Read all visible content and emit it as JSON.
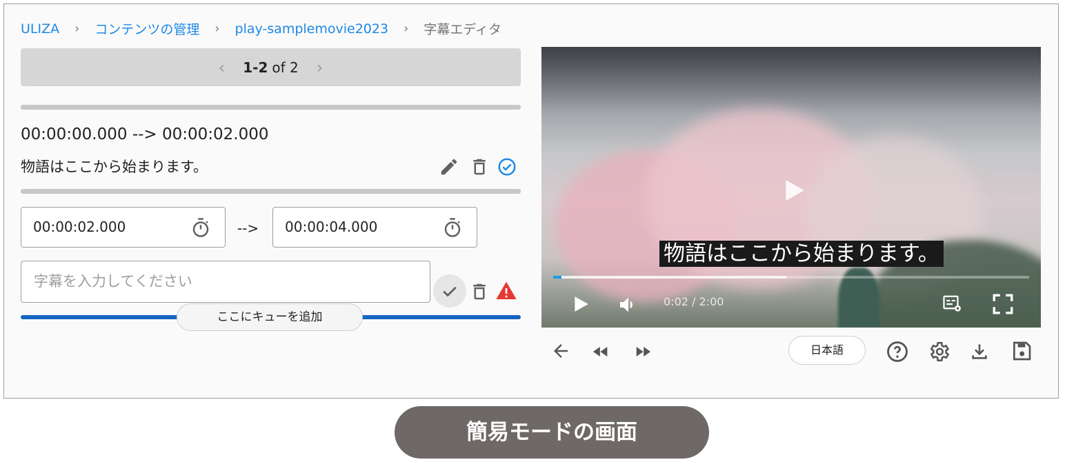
{
  "breadcrumb": {
    "items": [
      "ULIZA",
      "コンテンツの管理",
      "play-samplemovie2023"
    ],
    "current": "字幕エディタ"
  },
  "pagination": {
    "range": "1-2",
    "of_text": "of 2"
  },
  "cue1": {
    "time": "00:00:00.000 --> 00:00:02.000",
    "text": "物語はここから始まります。"
  },
  "cue2": {
    "start": "00:00:02.000",
    "arrow": "-->",
    "end": "00:00:04.000",
    "placeholder": "字幕を入力してください"
  },
  "add_cue_label": "ここにキューを追加",
  "video": {
    "caption": "物語はここから始まります。",
    "time": "0:02 / 2:00",
    "progress": 0.017,
    "buffered": 0.49
  },
  "language": "日本語",
  "mode_label": "簡易モードの画面",
  "colors": {
    "link": "#1e88e5",
    "accent_blue": "#1565c0",
    "warning": "#e53935",
    "badge": "#6e6866"
  },
  "icons": [
    "pencil-icon",
    "trash-icon",
    "check-circle-icon",
    "timer-icon",
    "check-icon",
    "warning-icon",
    "play-icon",
    "volume-icon",
    "subtitle-settings-icon",
    "fullscreen-icon",
    "back-arrow-icon",
    "rewind-icon",
    "fast-forward-icon",
    "help-icon",
    "gear-icon",
    "download-icon",
    "save-icon"
  ]
}
